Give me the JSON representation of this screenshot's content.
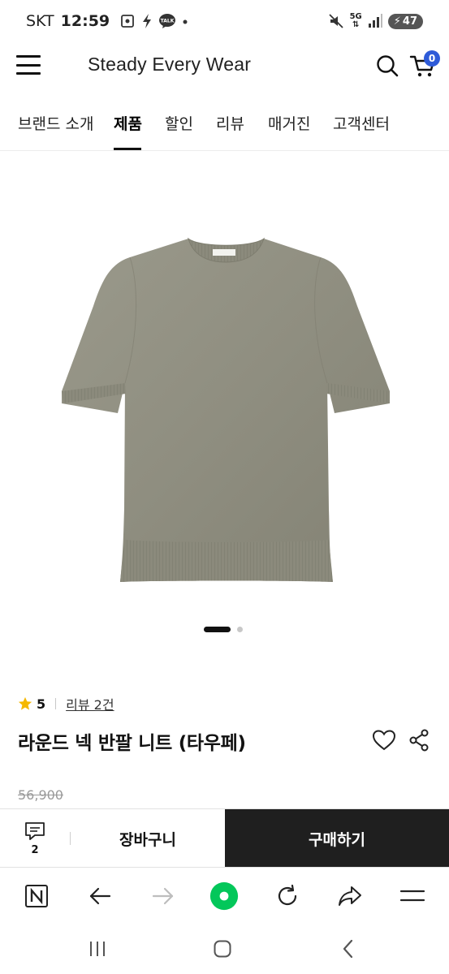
{
  "status_bar": {
    "carrier": "SKT",
    "time": "12:59",
    "notification_icons": [
      "screenshot-icon",
      "bolt-icon",
      "kakaotalk-icon",
      "dot-icon"
    ],
    "talk_label": "TALK",
    "network_label": "5G",
    "battery_level": "47"
  },
  "header": {
    "brand": "Steady Every Wear",
    "cart_count": "0"
  },
  "nav": {
    "items": [
      {
        "label": "브랜드 소개",
        "active": false
      },
      {
        "label": "제품",
        "active": true
      },
      {
        "label": "할인",
        "active": false
      },
      {
        "label": "리뷰",
        "active": false
      },
      {
        "label": "매거진",
        "active": false
      },
      {
        "label": "고객센터",
        "active": false
      }
    ]
  },
  "product": {
    "image_alt": "taupe short-sleeve knit",
    "image_color": "#8f8e80",
    "carousel": {
      "total": 2,
      "current": 1
    },
    "rating": "5",
    "review_link": "리뷰 2건",
    "name": "라운드 넥 반팔 니트 (타우페)",
    "original_price": "56,900"
  },
  "purchase_bar": {
    "qa_count": "2",
    "add_to_cart": "장바구니",
    "buy": "구매하기"
  },
  "browser_bar": {
    "icons": [
      "naver-icon",
      "back-arrow-icon",
      "forward-arrow-icon",
      "green-dot-icon",
      "refresh-icon",
      "share-arrow-icon",
      "hamburger-icon"
    ],
    "accent": "#03c75a"
  },
  "system_nav": {
    "icons": [
      "recents-icon",
      "home-icon",
      "back-icon"
    ]
  },
  "colors": {
    "accent_blue": "#2e5bd8",
    "buy_button": "#1f1f1f",
    "star": "#f5b800"
  }
}
